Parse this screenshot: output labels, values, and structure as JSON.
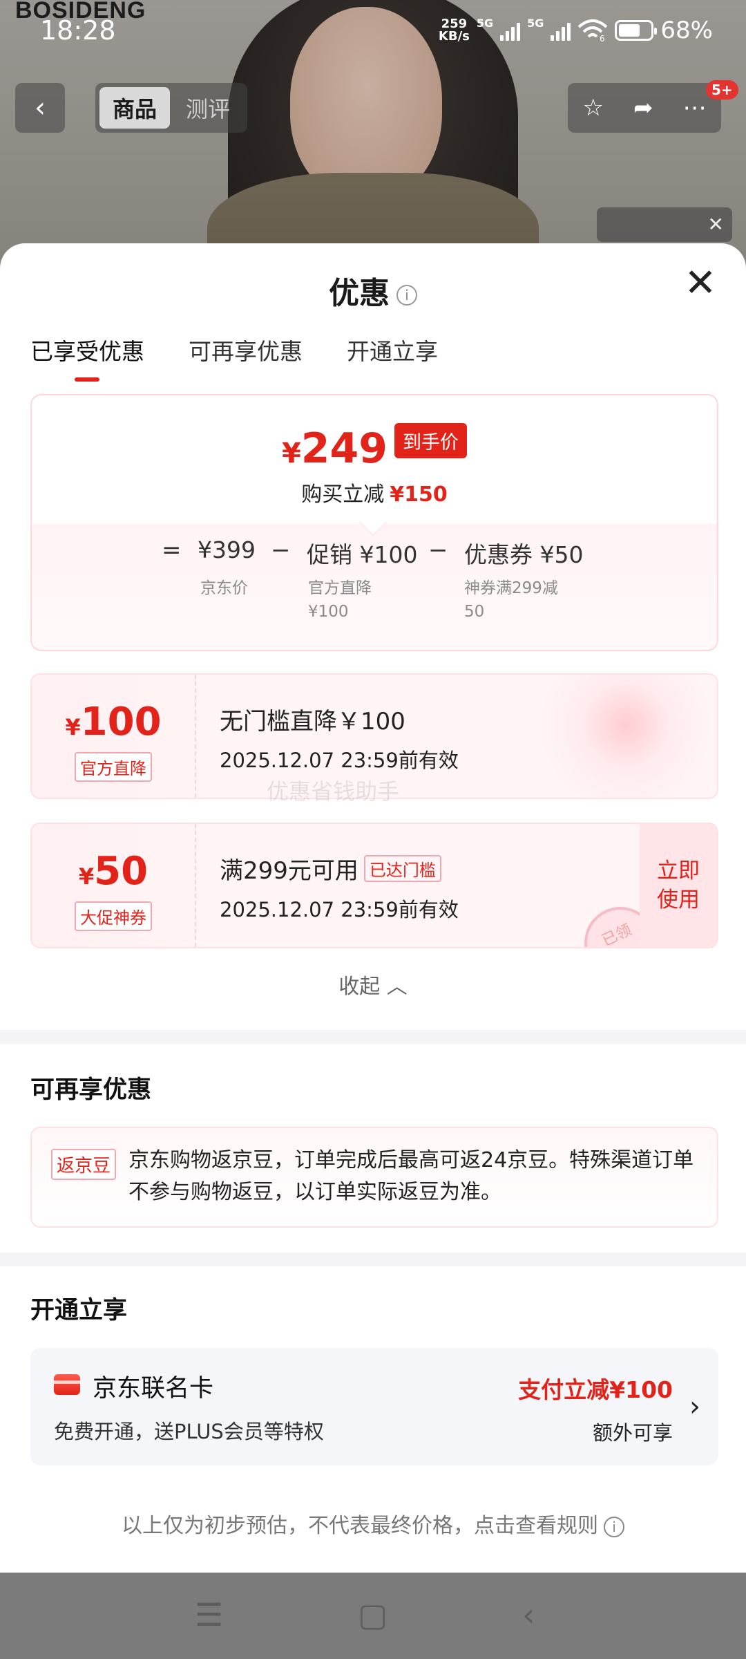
{
  "status_bar": {
    "time": "18:28",
    "net_speed_value": "259",
    "net_speed_unit": "KB/s",
    "sim1": "5G",
    "sim2": "5G",
    "wifi_label": "6",
    "battery": "68%"
  },
  "product_header": {
    "brand": "BOSIDENG",
    "tabs": [
      "商品",
      "测评"
    ],
    "active_tab": "商品",
    "notification_badge": "5+"
  },
  "sheet": {
    "title": "优惠",
    "tabs": [
      "已享受优惠",
      "可再享优惠",
      "开通立享"
    ],
    "active_tab": "已享受优惠"
  },
  "summary": {
    "currency": "¥",
    "final_price": "249",
    "final_tag": "到手价",
    "reduce_label": "购买立减",
    "reduce_amount": "¥150",
    "equals": "=",
    "minus": "−",
    "items": [
      {
        "main": "¥399",
        "sub1": "京东价",
        "sub2": ""
      },
      {
        "main": "促销 ¥100",
        "sub1": "官方直降",
        "sub2": "¥100"
      },
      {
        "main": "优惠券 ¥50",
        "sub1": "神券满299减",
        "sub2": "50"
      }
    ]
  },
  "coupons": [
    {
      "currency": "¥",
      "amount": "100",
      "label": "官方直降",
      "title": "无门槛直降￥100",
      "validity": "2025.12.07 23:59前有效"
    },
    {
      "currency": "¥",
      "amount": "50",
      "label": "大促神券",
      "title": "满299元可用",
      "badge": "已达门槛",
      "validity": "2025.12.07 23:59前有效",
      "action": "立即\n使用",
      "stamp": "已领"
    }
  ],
  "watermark": "优惠省钱助手",
  "collapse_label": "收起",
  "more_offers": {
    "title": "可再享优惠",
    "tag": "返京豆",
    "text": "京东购物返京豆，订单完成后最高可返24京豆。特殊渠道订单不参与购物返豆，以订单实际返豆为准。"
  },
  "open_offers": {
    "title": "开通立享",
    "card_name": "京东联名卡",
    "card_desc": "免费开通，送PLUS会员等特权",
    "offer": "支付立减¥100",
    "extra": "额外可享"
  },
  "footer_note": "以上仅为初步预估，不代表最终价格，点击查看规则",
  "colors": {
    "accent": "#e2231a",
    "pink_bg": "#fff5f6",
    "card_bg": "#f5f6fa"
  },
  "icons": [
    "back-icon",
    "star-icon",
    "share-icon",
    "more-icon",
    "info-icon",
    "close-icon",
    "chevron-up-icon",
    "chevron-right-icon",
    "card-icon",
    "menu-icon",
    "home-icon",
    "nav-back-icon"
  ]
}
